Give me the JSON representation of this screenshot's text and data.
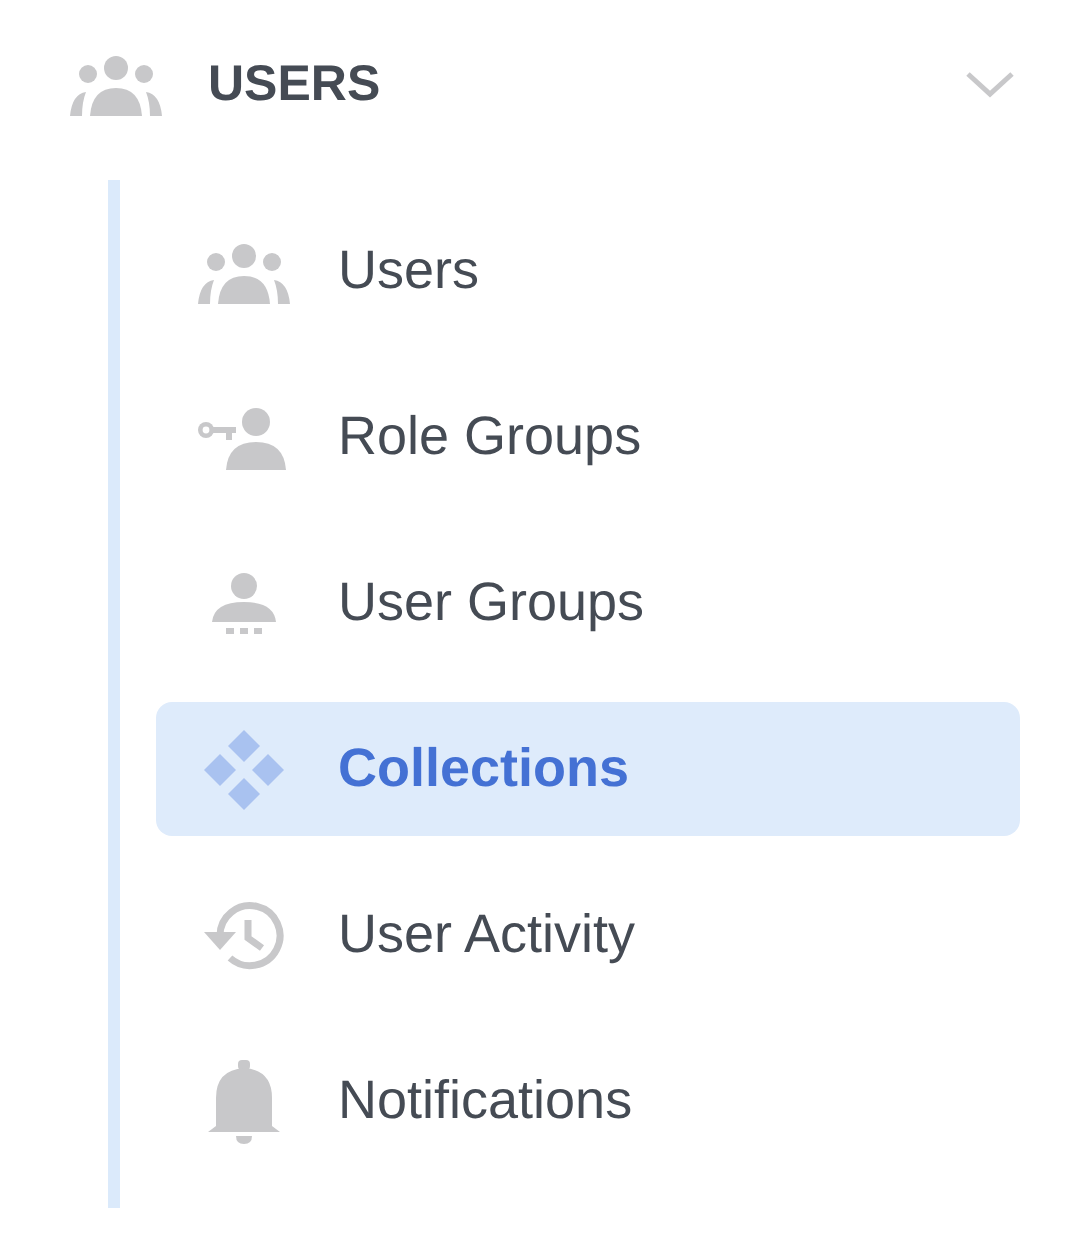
{
  "section": {
    "title": "USERS",
    "expanded": true
  },
  "items": [
    {
      "label": "Users",
      "kind": "users",
      "selected": false
    },
    {
      "label": "Role Groups",
      "kind": "role",
      "selected": false
    },
    {
      "label": "User Groups",
      "kind": "group",
      "selected": false
    },
    {
      "label": "Collections",
      "kind": "collections",
      "selected": true
    },
    {
      "label": "User Activity",
      "kind": "history",
      "selected": false
    },
    {
      "label": "Notifications",
      "kind": "bell",
      "selected": false
    }
  ]
}
